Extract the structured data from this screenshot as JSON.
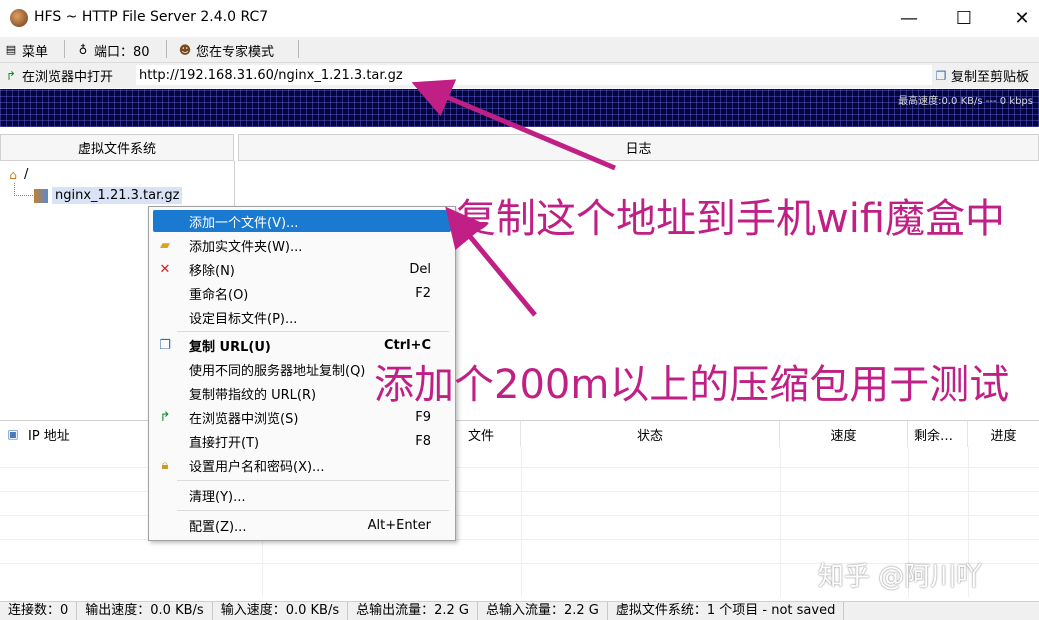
{
  "window": {
    "title": "HFS ~ HTTP File Server 2.4.0 RC7",
    "minimize": "—",
    "maximize": "☐",
    "close": "✕"
  },
  "menubar": {
    "menu": "菜单",
    "port": "端口：80",
    "mode": "您在专家模式"
  },
  "urlbar": {
    "open_browser": "在浏览器中打开",
    "url": "http://192.168.31.60/nginx_1.21.3.tar.gz",
    "copy_clipboard": "复制至剪贴板"
  },
  "graph": {
    "text": "最高速度:0.0 KB/s   ---   0 kbps"
  },
  "vfs": {
    "header": "虚拟文件系统",
    "root": "/",
    "file": "nginx_1.21.3.tar.gz"
  },
  "log": {
    "header": "日志"
  },
  "connections": {
    "columns": [
      "IP 地址",
      "文件",
      "状态",
      "速度",
      "剩余…",
      "进度"
    ]
  },
  "context_menu": {
    "items": [
      {
        "label": "添加一个文件(V)...",
        "key": "",
        "icon": ""
      },
      {
        "label": "添加实文件夹(W)...",
        "key": "",
        "icon": "folder-icon"
      },
      {
        "label": "移除(N)",
        "key": "Del",
        "icon": "red-x-icon"
      },
      {
        "label": "重命名(O)",
        "key": "F2",
        "icon": ""
      },
      {
        "label": "设定目标文件(P)...",
        "key": "",
        "icon": ""
      },
      {
        "label": "复制 URL(U)",
        "key": "Ctrl+C",
        "icon": "copy-icon"
      },
      {
        "label": "使用不同的服务器地址复制(Q)",
        "key": "",
        "icon": ""
      },
      {
        "label": "复制带指纹的 URL(R)",
        "key": "",
        "icon": ""
      },
      {
        "label": "在浏览器中浏览(S)",
        "key": "F9",
        "icon": "browse-arrow-icon"
      },
      {
        "label": "直接打开(T)",
        "key": "F8",
        "icon": ""
      },
      {
        "label": "设置用户名和密码(X)...",
        "key": "",
        "icon": "lock-icon"
      },
      {
        "label": "清理(Y)...",
        "key": "",
        "icon": ""
      },
      {
        "label": "配置(Z)...",
        "key": "Alt+Enter",
        "icon": ""
      }
    ]
  },
  "statusbar": {
    "items": [
      "连接数：0",
      "输出速度：0.0 KB/s",
      "输入速度：0.0 KB/s",
      "总输出流量：2.2 G",
      "总输入流量：2.2 G",
      "虚拟文件系统：1 个项目 - not saved"
    ]
  },
  "annotations": {
    "copy_address": "复制这个地址到手机wifi魔盒中",
    "add_package": "添加个200m以上的压缩包用于测试",
    "color": "#c01f86"
  },
  "watermark": "知乎 @阿川吖"
}
